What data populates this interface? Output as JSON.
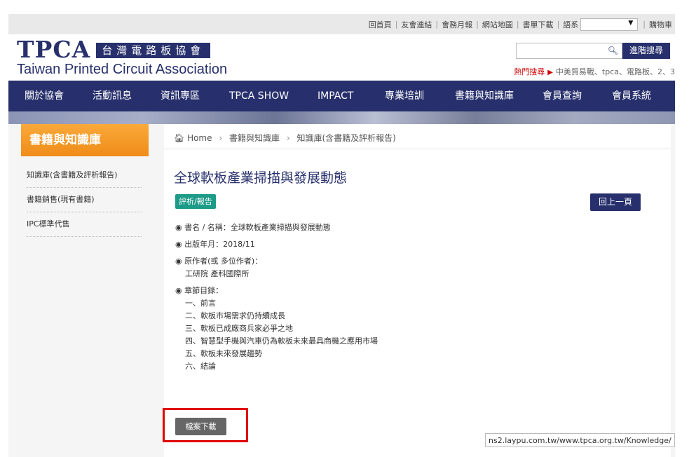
{
  "topbar": {
    "links": [
      "回首頁",
      "友會連結",
      "會務月報",
      "網站地圖",
      "書單下載",
      "語系"
    ],
    "cart": "購物車"
  },
  "logo": {
    "abbr": "TPCA",
    "chinese": "台灣電路板協會",
    "english": "Taiwan Printed Circuit Association"
  },
  "search": {
    "button_label": "進階搜尋",
    "hot_label": "熱門搜尋",
    "hot_items": "中美貿易戰、tpca、電路板、2、3"
  },
  "nav": [
    "關於協會",
    "活動訊息",
    "資訊專區",
    "TPCA SHOW",
    "IMPACT",
    "專業培訓",
    "書籍與知識庫",
    "會員查詢",
    "會員系統"
  ],
  "sidebar": {
    "title": "書籍與知識庫",
    "items": [
      "知識庫(含書籍及評析報告)",
      "書籍銷售(現有書籍)",
      "IPC標準代售"
    ]
  },
  "breadcrumb": [
    "Home",
    "書籍與知識庫",
    "知識庫(含書籍及評析報告)"
  ],
  "article": {
    "title": "全球軟板產業掃描與發展動態",
    "badge": "評析/報告",
    "back_label": "回上一頁",
    "book_name": "書名 / 名稱：全球軟板產業掃描與發展動態",
    "publish_date": "出版年月：2018/11",
    "author_label": "原作者(或 多位作者)：",
    "author": "工研院 產科國際所",
    "toc_label": "章節目錄：",
    "toc": [
      "一、前言",
      "二、軟板市場需求仍持續成長",
      "三、軟板已成廠商兵家必爭之地",
      "四、智慧型手機與汽車仍為軟板未來最具商機之應用市場",
      "五、軟板未來發展趨勢",
      "六、結論"
    ],
    "download_label": "檔案下載"
  },
  "status_url": "ns2.laypu.com.tw/www.tpca.org.tw/Knowledge/"
}
